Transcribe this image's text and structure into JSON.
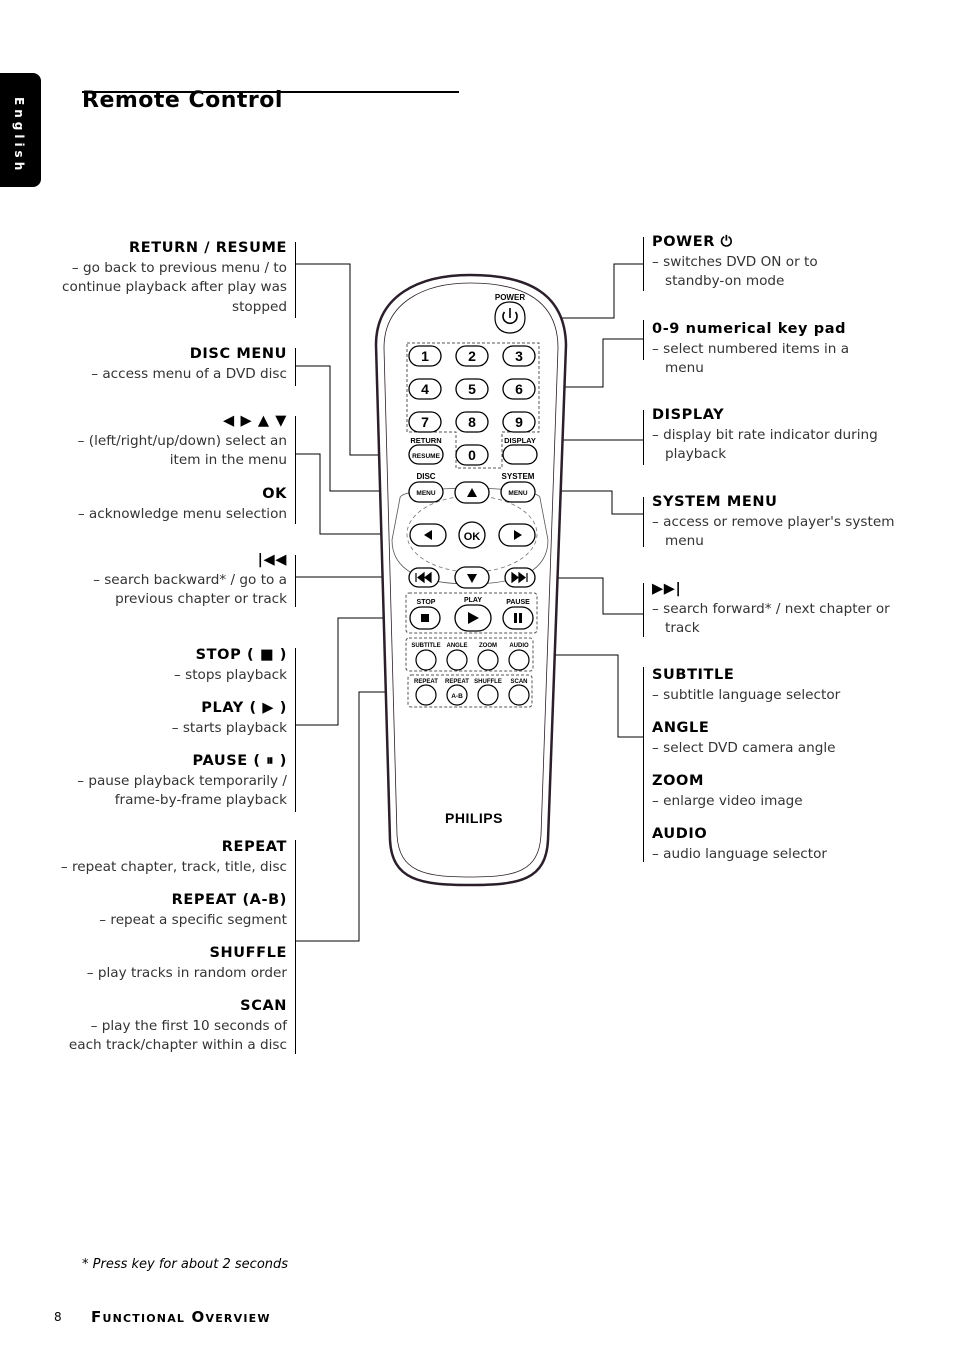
{
  "sidebar_tab": {
    "label": "English"
  },
  "page": {
    "title": "Remote Control",
    "footnote": "* Press key for about 2 seconds",
    "page_number": "8",
    "section_title": "Functional Overview"
  },
  "left_callouts": [
    {
      "heading": "RETURN / RESUME",
      "desc": "– go back to previous menu / to continue playback after play was stopped"
    },
    {
      "heading": "DISC MENU",
      "desc": "– access menu of a DVD disc"
    },
    {
      "heading": "◀ ▶ ▲ ▼",
      "desc": "– (left/right/up/down) select an item in the menu"
    },
    {
      "heading": "OK",
      "desc": "– acknowledge menu selection"
    },
    {
      "heading": "|◀◀",
      "desc": "– search backward* / go to a previous chapter or track"
    },
    {
      "heading": "STOP ( ■ )",
      "desc": "– stops playback"
    },
    {
      "heading": "PLAY ( ▶ )",
      "desc": "– starts playback"
    },
    {
      "heading": "PAUSE ( ⏸ )",
      "desc": "– pause playback temporarily / frame-by-frame playback"
    },
    {
      "heading": "REPEAT",
      "desc": "– repeat chapter, track, title, disc"
    },
    {
      "heading": "REPEAT (A-B)",
      "desc": "– repeat a specific segment"
    },
    {
      "heading": "SHUFFLE",
      "desc": "– play tracks in random order"
    },
    {
      "heading": "SCAN",
      "desc": "– play the first 10 seconds of each track/chapter within a disc"
    }
  ],
  "right_callouts": [
    {
      "heading": "POWER ⏻",
      "desc": "– switches DVD ON or to standby-on mode"
    },
    {
      "heading": "0-9 numerical key pad",
      "desc": "– select numbered items in a menu"
    },
    {
      "heading": "DISPLAY",
      "desc": "– display bit rate indicator during playback"
    },
    {
      "heading": "SYSTEM MENU",
      "desc": "– access or remove player's system menu"
    },
    {
      "heading": "▶▶|",
      "desc": "– search forward* / next chapter or track"
    },
    {
      "heading": "SUBTITLE",
      "desc": "– subtitle language selector"
    },
    {
      "heading": "ANGLE",
      "desc": "– select DVD camera angle"
    },
    {
      "heading": "ZOOM",
      "desc": "– enlarge video image"
    },
    {
      "heading": "AUDIO",
      "desc": "– audio language selector"
    }
  ],
  "remote": {
    "brand": "PHILIPS",
    "power_label": "POWER",
    "digits": [
      "1",
      "2",
      "3",
      "4",
      "5",
      "6",
      "7",
      "8",
      "9",
      "0"
    ],
    "return_label": "RETURN",
    "resume_label": "RESUME",
    "display_label": "DISPLAY",
    "disc_label": "DISC",
    "system_label": "SYSTEM",
    "menu_label": "MENU",
    "ok_label": "OK",
    "stop_label": "STOP",
    "play_label": "PLAY",
    "pause_label": "PAUSE",
    "row1_labels": [
      "SUBTITLE",
      "ANGLE",
      "ZOOM",
      "AUDIO"
    ],
    "row2_labels": [
      "REPEAT",
      "REPEAT",
      "SHUFFLE",
      "SCAN"
    ],
    "ab_label": "A-B"
  }
}
